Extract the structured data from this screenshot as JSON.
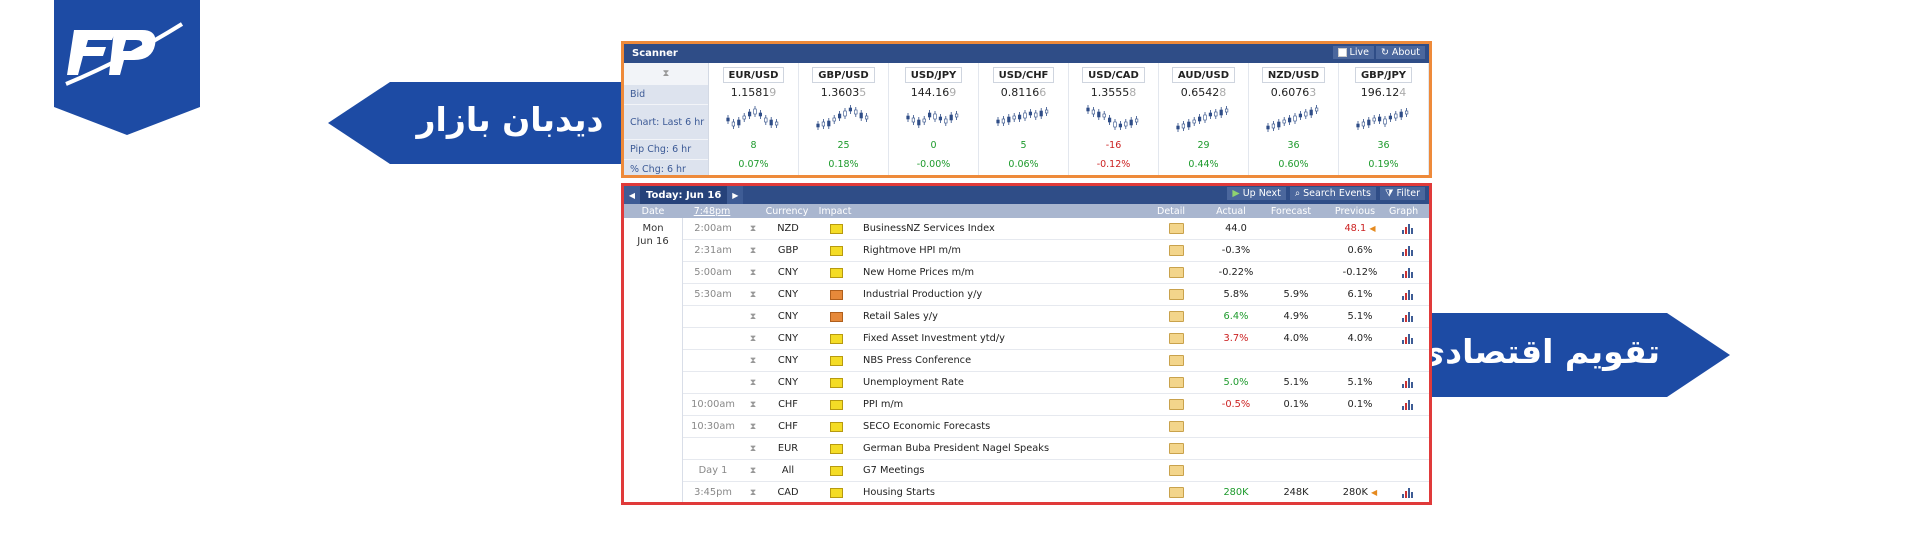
{
  "colors": {
    "brand_blue": "#1d4ba4",
    "scanner_border": "#ee8a3a",
    "calendar_border": "#e03a3a",
    "header_navy": "#2f4d87"
  },
  "logo": {
    "icon": "fp-logo-icon"
  },
  "callouts": {
    "market_watch": "دیدبان بازار",
    "economic_calendar": "تقویم اقتصادی"
  },
  "scanner": {
    "title": "Scanner",
    "live_label": "Live",
    "about_label": "About",
    "row_labels": {
      "bid": "Bid",
      "chart": "Chart: Last 6 hr",
      "pip": "Pip Chg: 6 hr",
      "pct": "% Chg: 6 hr"
    },
    "pairs": [
      {
        "name": "EUR/USD",
        "bid_main": "1.1581",
        "bid_dim": "9",
        "pip": "8",
        "pct": "0.07%",
        "dir": "pos"
      },
      {
        "name": "GBP/USD",
        "bid_main": "1.3603",
        "bid_dim": "5",
        "pip": "25",
        "pct": "0.18%",
        "dir": "pos"
      },
      {
        "name": "USD/JPY",
        "bid_main": "144.16",
        "bid_dim": "9",
        "pip": "0",
        "pct": "-0.00%",
        "dir": "neu"
      },
      {
        "name": "USD/CHF",
        "bid_main": "0.8116",
        "bid_dim": "6",
        "pip": "5",
        "pct": "0.06%",
        "dir": "pos"
      },
      {
        "name": "USD/CAD",
        "bid_main": "1.3555",
        "bid_dim": "8",
        "pip": "-16",
        "pct": "-0.12%",
        "dir": "neg"
      },
      {
        "name": "AUD/USD",
        "bid_main": "0.6542",
        "bid_dim": "8",
        "pip": "29",
        "pct": "0.44%",
        "dir": "pos"
      },
      {
        "name": "NZD/USD",
        "bid_main": "0.6076",
        "bid_dim": "3",
        "pip": "36",
        "pct": "0.60%",
        "dir": "pos"
      },
      {
        "name": "GBP/JPY",
        "bid_main": "196.12",
        "bid_dim": "4",
        "pip": "36",
        "pct": "0.19%",
        "dir": "pos"
      }
    ]
  },
  "calendar": {
    "today_label": "Today: Jun 16",
    "up_next": "Up Next",
    "search_events": "Search Events",
    "filter": "Filter",
    "headers": {
      "date": "Date",
      "time": "7:48pm",
      "currency": "Currency",
      "impact": "Impact",
      "detail": "Detail",
      "actual": "Actual",
      "forecast": "Forecast",
      "previous": "Previous",
      "graph": "Graph"
    },
    "date_day": "Mon",
    "date_md": "Jun 16",
    "rows": [
      {
        "time": "2:00am",
        "cur": "NZD",
        "impact": "yellow",
        "event": "BusinessNZ Services Index",
        "actual": "44.0",
        "actual_dir": "",
        "forecast": "",
        "previous": "48.1",
        "prev_dir": "neg",
        "rev": true,
        "graph": true
      },
      {
        "time": "2:31am",
        "cur": "GBP",
        "impact": "yellow",
        "event": "Rightmove HPI m/m",
        "actual": "-0.3%",
        "actual_dir": "",
        "forecast": "",
        "previous": "0.6%",
        "prev_dir": "",
        "rev": false,
        "graph": true
      },
      {
        "time": "5:00am",
        "cur": "CNY",
        "impact": "yellow",
        "event": "New Home Prices m/m",
        "actual": "-0.22%",
        "actual_dir": "",
        "forecast": "",
        "previous": "-0.12%",
        "prev_dir": "",
        "rev": false,
        "graph": true
      },
      {
        "time": "5:30am",
        "cur": "CNY",
        "impact": "orange",
        "event": "Industrial Production y/y",
        "actual": "5.8%",
        "actual_dir": "",
        "forecast": "5.9%",
        "previous": "6.1%",
        "prev_dir": "",
        "rev": false,
        "graph": true
      },
      {
        "time": "",
        "cur": "CNY",
        "impact": "orange",
        "event": "Retail Sales y/y",
        "actual": "6.4%",
        "actual_dir": "pos",
        "forecast": "4.9%",
        "previous": "5.1%",
        "prev_dir": "",
        "rev": false,
        "graph": true
      },
      {
        "time": "",
        "cur": "CNY",
        "impact": "yellow",
        "event": "Fixed Asset Investment ytd/y",
        "actual": "3.7%",
        "actual_dir": "neg",
        "forecast": "4.0%",
        "previous": "4.0%",
        "prev_dir": "",
        "rev": false,
        "graph": true
      },
      {
        "time": "",
        "cur": "CNY",
        "impact": "yellow",
        "event": "NBS Press Conference",
        "actual": "",
        "actual_dir": "",
        "forecast": "",
        "previous": "",
        "prev_dir": "",
        "rev": false,
        "graph": false
      },
      {
        "time": "",
        "cur": "CNY",
        "impact": "yellow",
        "event": "Unemployment Rate",
        "actual": "5.0%",
        "actual_dir": "pos",
        "forecast": "5.1%",
        "previous": "5.1%",
        "prev_dir": "",
        "rev": false,
        "graph": true
      },
      {
        "time": "10:00am",
        "cur": "CHF",
        "impact": "yellow",
        "event": "PPI m/m",
        "actual": "-0.5%",
        "actual_dir": "neg",
        "forecast": "0.1%",
        "previous": "0.1%",
        "prev_dir": "",
        "rev": false,
        "graph": true
      },
      {
        "time": "10:30am",
        "cur": "CHF",
        "impact": "yellow",
        "event": "SECO Economic Forecasts",
        "actual": "",
        "actual_dir": "",
        "forecast": "",
        "previous": "",
        "prev_dir": "",
        "rev": false,
        "graph": false
      },
      {
        "time": "",
        "cur": "EUR",
        "impact": "yellow",
        "event": "German Buba President Nagel Speaks",
        "actual": "",
        "actual_dir": "",
        "forecast": "",
        "previous": "",
        "prev_dir": "",
        "rev": false,
        "graph": false
      },
      {
        "time": "Day 1",
        "cur": "All",
        "impact": "yellow",
        "event": "G7 Meetings",
        "actual": "",
        "actual_dir": "",
        "forecast": "",
        "previous": "",
        "prev_dir": "",
        "rev": false,
        "graph": false
      },
      {
        "time": "3:45pm",
        "cur": "CAD",
        "impact": "yellow",
        "event": "Housing Starts",
        "actual": "280K",
        "actual_dir": "pos",
        "forecast": "248K",
        "previous": "280K",
        "prev_dir": "",
        "rev": true,
        "graph": true
      }
    ]
  }
}
